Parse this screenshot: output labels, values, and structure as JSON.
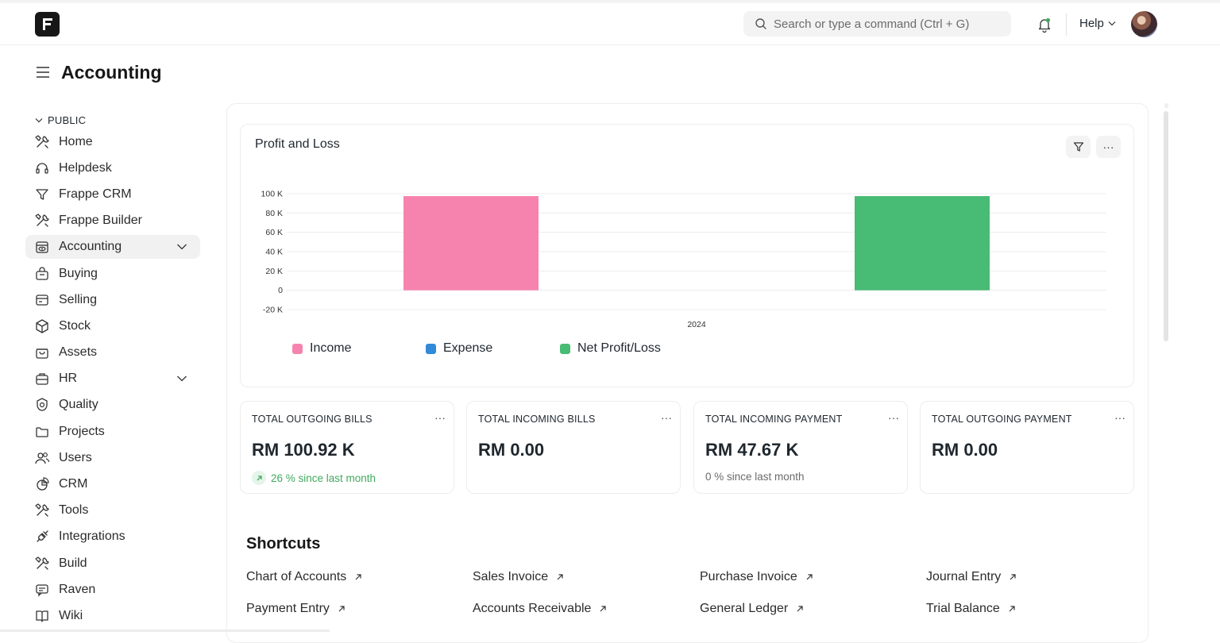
{
  "navbar": {
    "search_placeholder": "Search or type a command (Ctrl + G)",
    "help_label": "Help"
  },
  "page": {
    "title": "Accounting"
  },
  "sidebar": {
    "section_label": "PUBLIC",
    "items": [
      {
        "label": "Home",
        "icon": "tools-icon"
      },
      {
        "label": "Helpdesk",
        "icon": "headset-icon"
      },
      {
        "label": "Frappe CRM",
        "icon": "funnel-icon"
      },
      {
        "label": "Frappe Builder",
        "icon": "tools-icon"
      },
      {
        "label": "Accounting",
        "icon": "eye-icon",
        "active": true,
        "expandable": true
      },
      {
        "label": "Buying",
        "icon": "basket-icon"
      },
      {
        "label": "Selling",
        "icon": "card-icon"
      },
      {
        "label": "Stock",
        "icon": "box-icon"
      },
      {
        "label": "Assets",
        "icon": "bag-icon"
      },
      {
        "label": "HR",
        "icon": "briefcase-icon",
        "expandable": true
      },
      {
        "label": "Quality",
        "icon": "badge-icon"
      },
      {
        "label": "Projects",
        "icon": "folder-icon"
      },
      {
        "label": "Users",
        "icon": "users-icon"
      },
      {
        "label": "CRM",
        "icon": "pie-icon"
      },
      {
        "label": "Tools",
        "icon": "tools-icon"
      },
      {
        "label": "Integrations",
        "icon": "plug-icon"
      },
      {
        "label": "Build",
        "icon": "tools-icon"
      },
      {
        "label": "Raven",
        "icon": "chat-icon"
      },
      {
        "label": "Wiki",
        "icon": "book-icon"
      }
    ]
  },
  "chart_data": {
    "type": "bar",
    "title": "Profit and Loss",
    "categories": [
      "2024"
    ],
    "series": [
      {
        "name": "Income",
        "values": [
          97500
        ],
        "color": "#f683ae"
      },
      {
        "name": "Expense",
        "values": [
          0
        ],
        "color": "#318ad8"
      },
      {
        "name": "Net Profit/Loss",
        "values": [
          97500
        ],
        "color": "#48bb74"
      }
    ],
    "yticks": [
      "100 K",
      "80 K",
      "60 K",
      "40 K",
      "20 K",
      "0",
      "-20 K"
    ],
    "ytick_values": [
      100000,
      80000,
      60000,
      40000,
      20000,
      0,
      -20000
    ],
    "ylim": [
      -20000,
      100000
    ],
    "grid": true,
    "legend_position": "bottom-left"
  },
  "stats": [
    {
      "label": "TOTAL OUTGOING BILLS",
      "value": "RM 100.92 K",
      "delta": "26 % since last month",
      "trend": "up"
    },
    {
      "label": "TOTAL INCOMING BILLS",
      "value": "RM 0.00",
      "delta": "",
      "trend": "none"
    },
    {
      "label": "TOTAL INCOMING PAYMENT",
      "value": "RM 47.67 K",
      "delta": "0 % since last month",
      "trend": "flat"
    },
    {
      "label": "TOTAL OUTGOING PAYMENT",
      "value": "RM 0.00",
      "delta": "",
      "trend": "none"
    }
  ],
  "shortcuts": {
    "title": "Shortcuts",
    "items": [
      "Chart of Accounts",
      "Sales Invoice",
      "Purchase Invoice",
      "Journal Entry",
      "Payment Entry",
      "Accounts Receivable",
      "General Ledger",
      "Trial Balance"
    ]
  }
}
